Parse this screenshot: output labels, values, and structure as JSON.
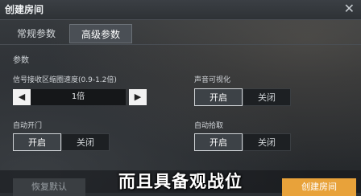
{
  "window": {
    "title": "创建房间",
    "close_icon": "close-icon"
  },
  "tabs": [
    {
      "label": "常规参数"
    },
    {
      "label": "高级参数"
    }
  ],
  "section_title": "参数",
  "settings": {
    "signal_zoom": {
      "label": "信号接收区缩圈速度(0.9-1.2倍)",
      "value": "1倍",
      "prev_icon": "triangle-left-icon",
      "next_icon": "triangle-right-icon"
    },
    "sound_visual": {
      "label": "声音可视化",
      "on": "开启",
      "off": "关闭",
      "selected": "开启"
    },
    "auto_door": {
      "label": "自动开门",
      "on": "开启",
      "off": "关闭",
      "selected": "开启"
    },
    "auto_pickup": {
      "label": "自动拾取",
      "on": "开启",
      "off": "关闭",
      "selected": "开启"
    }
  },
  "footer": {
    "restore_label": "恢复默认",
    "create_label": "创建房间"
  },
  "subtitle": "而且具备观战位"
}
